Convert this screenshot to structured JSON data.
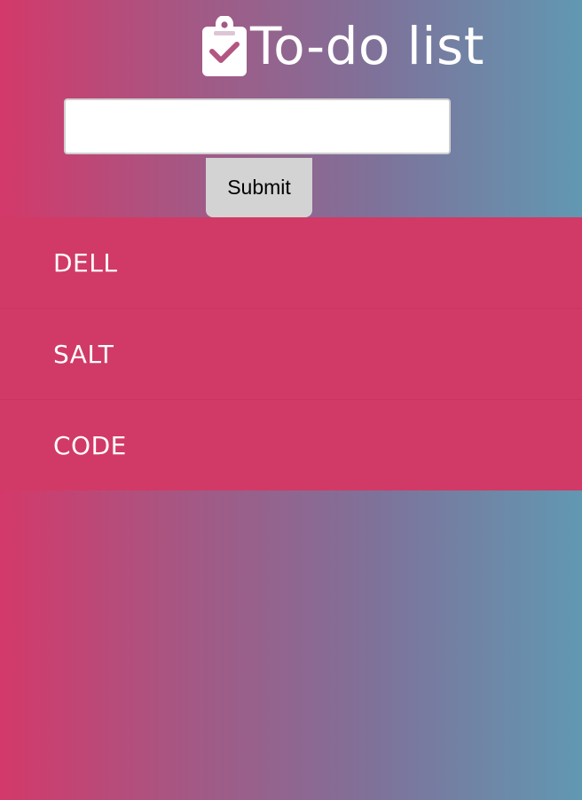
{
  "header": {
    "title": "To-do list",
    "icon": "clipboard-check-icon"
  },
  "form": {
    "input_value": "",
    "input_placeholder": "",
    "submit_label": "Submit"
  },
  "todos": [
    {
      "label": "DELL"
    },
    {
      "label": "SALT"
    },
    {
      "label": "CODE"
    }
  ],
  "colors": {
    "gradient_start": "#d3396a",
    "gradient_end": "#6198b2",
    "item_background": "#d13a66",
    "button_background": "#d3d3d3",
    "text_light": "#ffffff"
  }
}
